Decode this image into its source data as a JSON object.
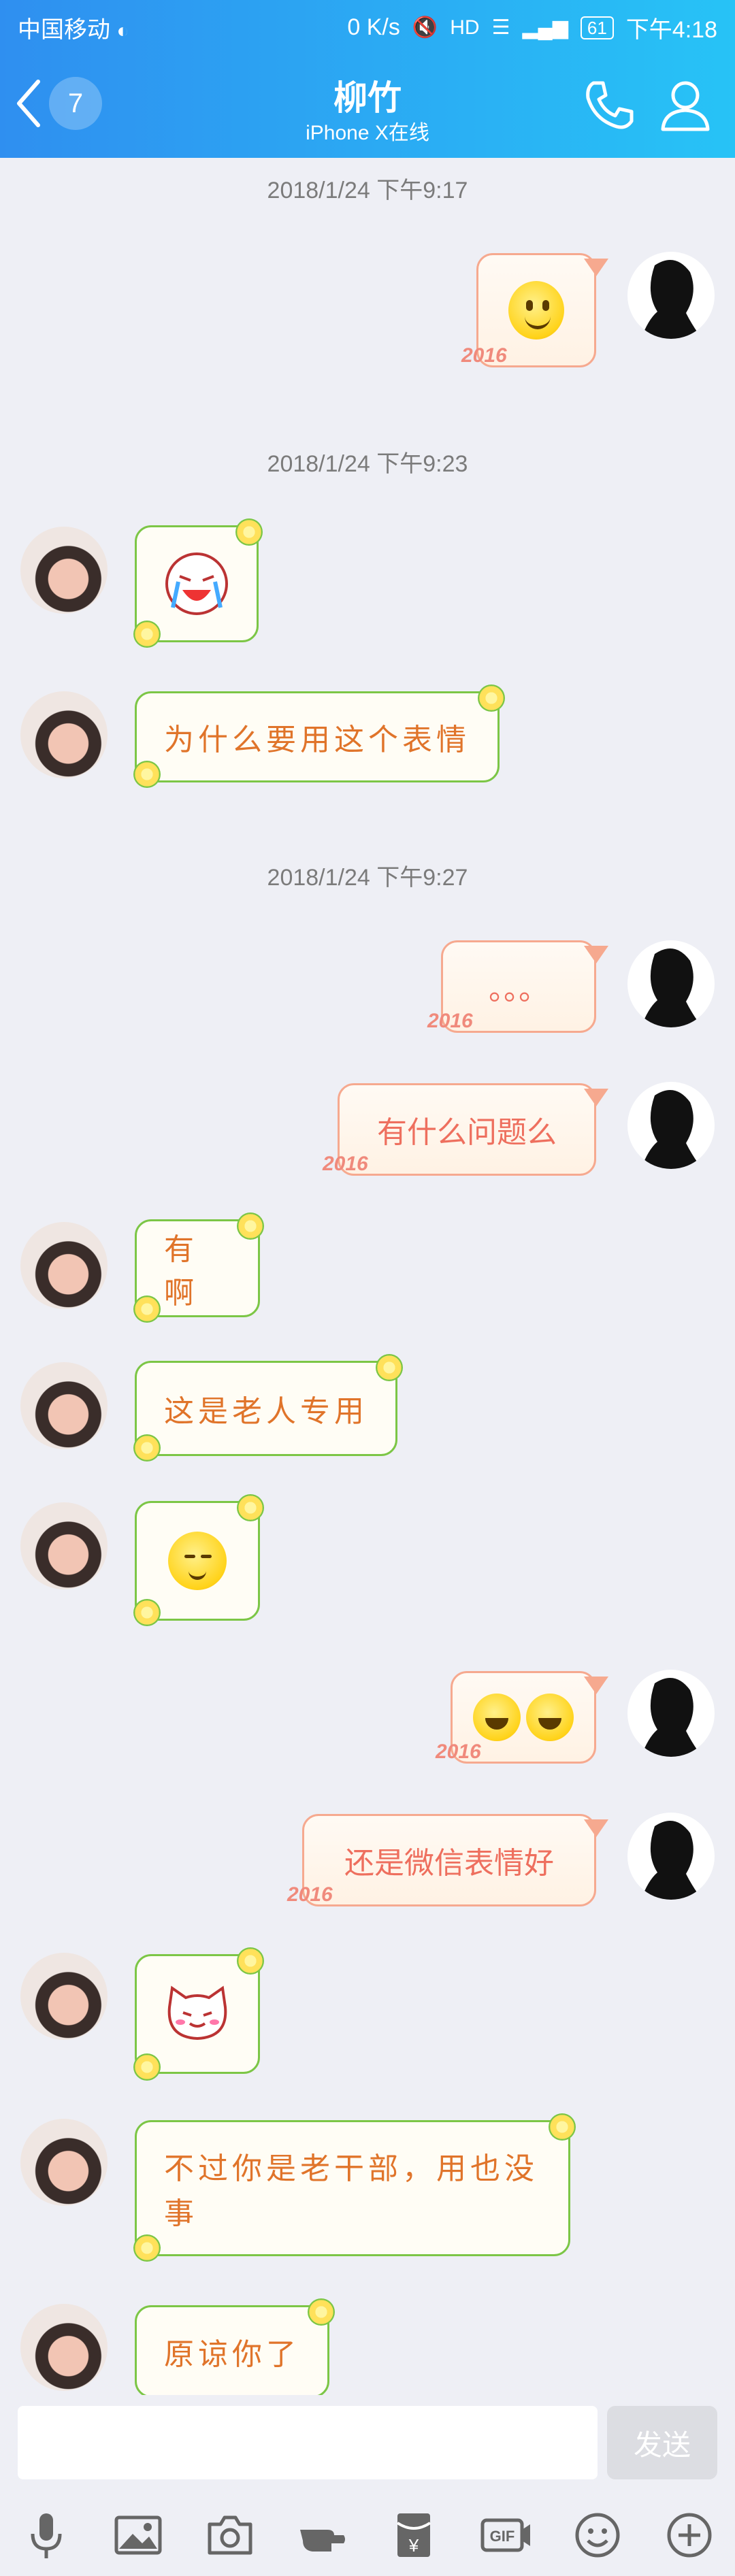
{
  "status_bar": {
    "carrier": "中国移动",
    "speed": "0 K/s",
    "battery": "61",
    "time": "下午4:18"
  },
  "header": {
    "unread_count": "7",
    "contact_name": "柳竹",
    "contact_status": "iPhone X在线"
  },
  "messages": [
    {
      "timestamp": "2018/1/24 下午9:17"
    },
    {
      "from": "me",
      "kind": "emoji",
      "emoji": "smile"
    },
    {
      "timestamp": "2018/1/24 下午9:23"
    },
    {
      "from": "her",
      "kind": "sticker",
      "emoji": "crying-laugh-sticker"
    },
    {
      "from": "her",
      "text": "为什么要用这个表情"
    },
    {
      "timestamp": "2018/1/24 下午9:27"
    },
    {
      "from": "me",
      "text": "。。。"
    },
    {
      "from": "me",
      "text": "有什么问题么"
    },
    {
      "from": "her",
      "text": "有啊"
    },
    {
      "from": "her",
      "text": "这是老人专用"
    },
    {
      "from": "her",
      "kind": "emoji",
      "emoji": "relieved"
    },
    {
      "from": "me",
      "kind": "emoji",
      "emoji": "tears-of-joy x2"
    },
    {
      "from": "me",
      "text": "还是微信表情好"
    },
    {
      "from": "her",
      "kind": "sticker",
      "emoji": "cat-face-sticker"
    },
    {
      "from": "her",
      "text": "不过你是老干部，用也没事"
    },
    {
      "from": "her",
      "text": "原谅你了"
    }
  ],
  "bubble_year_tag": "2016",
  "input": {
    "placeholder": "",
    "send_label": "发送"
  },
  "toolbar": {
    "gif_label": "GIF",
    "yuan_label": "¥"
  }
}
